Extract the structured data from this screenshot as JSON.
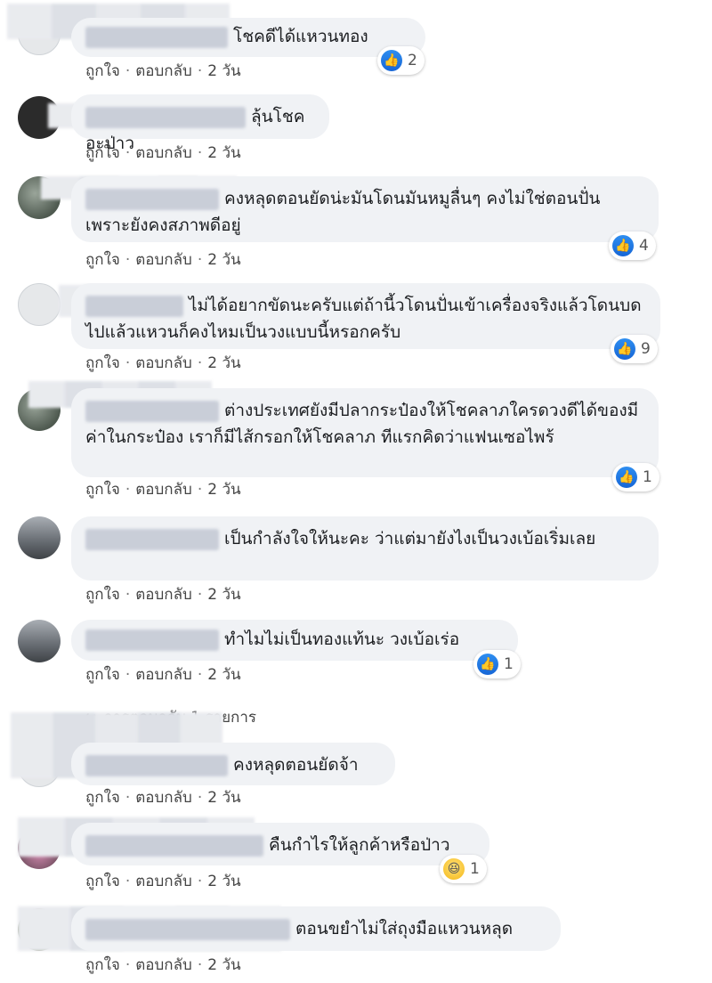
{
  "comments": [
    {
      "text": "โชคดีได้แหวนทอง",
      "actions": {
        "like": "ถูกใจ",
        "reply": "ตอบกลับ",
        "time": "2 วัน"
      },
      "reaction": {
        "type": "like",
        "count": "2"
      }
    },
    {
      "text": "ลุ้นโชคอะป่าว",
      "actions": {
        "like": "ถูกใจ",
        "reply": "ตอบกลับ",
        "time": "2 วัน"
      }
    },
    {
      "text": "คงหลุดตอนยัดน่ะมันโดนมันหมูลื่นๆ คงไม่ใช่ตอนปั่นเพราะยังคงสภาพดีอยู่",
      "actions": {
        "like": "ถูกใจ",
        "reply": "ตอบกลับ",
        "time": "2 วัน"
      },
      "reaction": {
        "type": "like",
        "count": "4"
      }
    },
    {
      "text": "ไม่ได้อยากขัดนะครับแต่ถ้านี้วโดนปั่นเข้าเครื่องจริงแล้วโดนบดไปแล้วแหวนก็คงไหมเป็นวงแบบนี้หรอกครับ",
      "actions": {
        "like": "ถูกใจ",
        "reply": "ตอบกลับ",
        "time": "2 วัน"
      },
      "reaction": {
        "type": "like",
        "count": "9"
      }
    },
    {
      "text": "ต่างประเทศยังมีปลากระป๋องให้โชคลาภใครดวงดีได้ของมีค่าในกระป๋อง เราก็มีไส้กรอกให้โชคลาภ ทีแรกคิดว่าแฟนเซอไพร้",
      "actions": {
        "like": "ถูกใจ",
        "reply": "ตอบกลับ",
        "time": "2 วัน"
      },
      "reaction": {
        "type": "like",
        "count": "1"
      }
    },
    {
      "text": "เป็นกำลังใจให้นะคะ ว่าแต่มายังไงเป็นวงเบ้อเริ่มเลย",
      "actions": {
        "like": "ถูกใจ",
        "reply": "ตอบกลับ",
        "time": "2 วัน"
      }
    },
    {
      "text": "ทำไมไม่เป็นทองแท้นะ วงเบ้อเร่อ",
      "actions": {
        "like": "ถูกใจ",
        "reply": "ตอบกลับ",
        "time": "2 วัน"
      },
      "reaction": {
        "type": "like",
        "count": "1"
      }
    },
    {
      "text": "คงหลุดตอนยัดจ้า",
      "actions": {
        "like": "ถูกใจ",
        "reply": "ตอบกลับ",
        "time": "2 วัน"
      }
    },
    {
      "text": "คืนกำไรให้ลูกค้าหรือป่าว",
      "actions": {
        "like": "ถูกใจ",
        "reply": "ตอบกลับ",
        "time": "2 วัน"
      },
      "reaction": {
        "type": "haha",
        "count": "1"
      }
    },
    {
      "text": "ตอนขยำไม่ใส่ถุงมือแหวนหลุด",
      "actions": {
        "like": "ถูกใจ",
        "reply": "ตอบกลับ",
        "time": "2 วัน"
      }
    }
  ],
  "replies_link": "การตอบกลับ 1 รายการ",
  "icons": {
    "like": "like-icon",
    "haha": "haha-icon"
  },
  "colors": {
    "bubble": "#f0f2f5",
    "like_blue": "#1877f2"
  }
}
